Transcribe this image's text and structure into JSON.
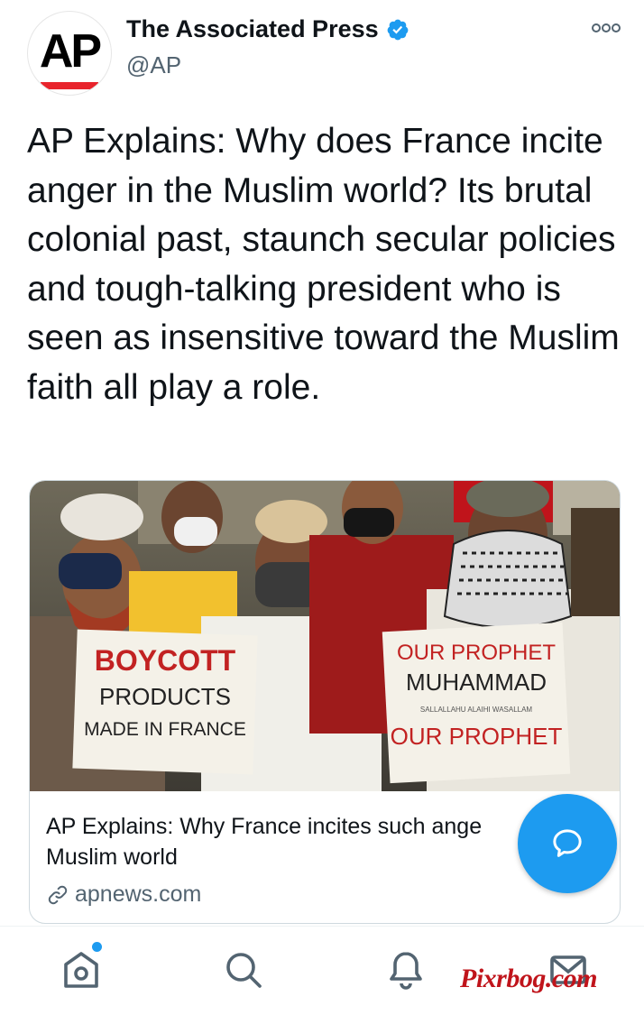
{
  "author": {
    "avatar_text": "AP",
    "name": "The Associated Press",
    "handle": "@AP",
    "verified_icon": "verified-badge-icon"
  },
  "tweet": {
    "text": "AP Explains: Why does France incite anger in the Muslim world? Its brutal colonial past, staunch secular policies and tough-talking president who is seen as insensitive toward the Muslim faith all play a role."
  },
  "card": {
    "image_signs": {
      "left_sign": [
        "BOYCOTT",
        "PRODUCTS",
        "MADE IN FRANCE"
      ],
      "right_sign": [
        "OUR PROPHET",
        "MUHAMMAD",
        "SALLALLAHU ALAIHI WASALLAM",
        "OUR PROPHET"
      ]
    },
    "title": "AP Explains: Why France incites such ange",
    "title_line2": "Muslim world",
    "domain": "apnews.com"
  },
  "colors": {
    "accent": "#1d9bf0",
    "text": "#0f1419",
    "secondary": "#536471"
  },
  "nav": {
    "items": [
      "home-icon",
      "search-icon",
      "notifications-icon",
      "messages-icon"
    ]
  },
  "watermark": "Pixrbog.com"
}
